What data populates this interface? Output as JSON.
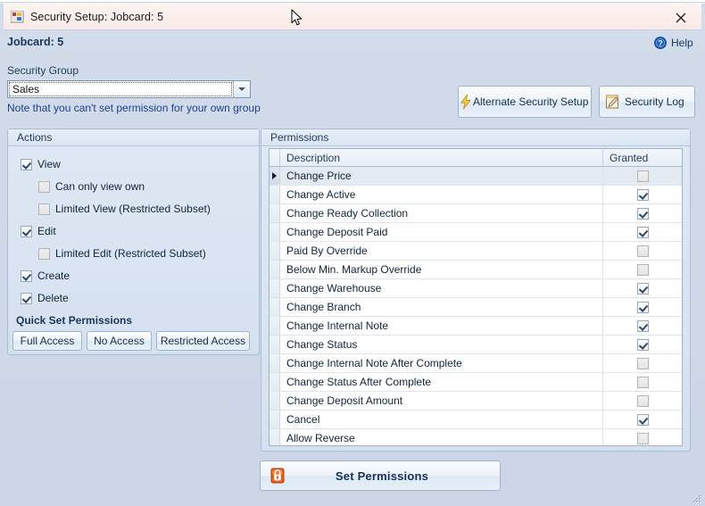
{
  "window": {
    "title": "Security Setup: Jobcard: 5",
    "app_icon": "windows-app-icon",
    "close_label": "✕"
  },
  "header": {
    "jobcard": "Jobcard: 5",
    "help_label": "Help",
    "help_icon": "help-question-icon"
  },
  "security_group": {
    "label": "Security Group",
    "selected": "Sales",
    "options": [
      "Sales"
    ],
    "note": "Note that you can't set permission for your own group"
  },
  "top_buttons": [
    {
      "label": "Alternate Security Setup",
      "icon": "lightning-bolt-icon"
    },
    {
      "label": "Security Log",
      "icon": "notepad-pencil-icon"
    }
  ],
  "actions": {
    "title": "Actions",
    "items": [
      {
        "label": "View",
        "checked": true,
        "indent": 0,
        "disabled": false
      },
      {
        "label": "Can only view own",
        "checked": false,
        "indent": 1,
        "disabled": true
      },
      {
        "label": "Limited View (Restricted Subset)",
        "checked": false,
        "indent": 1,
        "disabled": true
      },
      {
        "label": "Edit",
        "checked": true,
        "indent": 0,
        "disabled": false
      },
      {
        "label": "Limited Edit (Restricted Subset)",
        "checked": false,
        "indent": 1,
        "disabled": true
      },
      {
        "label": "Create",
        "checked": true,
        "indent": 0,
        "disabled": false
      },
      {
        "label": "Delete",
        "checked": true,
        "indent": 0,
        "disabled": false
      }
    ],
    "quick_set_title": "Quick Set Permissions",
    "quick_buttons": [
      {
        "label": "Full Access"
      },
      {
        "label": "No Access"
      },
      {
        "label": "Restricted Access"
      }
    ]
  },
  "permissions": {
    "title": "Permissions",
    "columns": [
      "Description",
      "Granted"
    ],
    "rows": [
      {
        "description": "Change Price",
        "granted": false,
        "selected": true
      },
      {
        "description": "Change Active",
        "granted": true,
        "selected": false
      },
      {
        "description": "Change Ready Collection",
        "granted": true,
        "selected": false
      },
      {
        "description": "Change Deposit Paid",
        "granted": true,
        "selected": false
      },
      {
        "description": "Paid By Override",
        "granted": false,
        "selected": false
      },
      {
        "description": "Below Min. Markup Override",
        "granted": false,
        "selected": false
      },
      {
        "description": "Change Warehouse",
        "granted": true,
        "selected": false
      },
      {
        "description": "Change Branch",
        "granted": true,
        "selected": false
      },
      {
        "description": "Change Internal Note",
        "granted": true,
        "selected": false
      },
      {
        "description": "Change Status",
        "granted": true,
        "selected": false
      },
      {
        "description": "Change Internal Note After Complete",
        "granted": false,
        "selected": false
      },
      {
        "description": "Change Status After Complete",
        "granted": false,
        "selected": false
      },
      {
        "description": "Change Deposit Amount",
        "granted": false,
        "selected": false
      },
      {
        "description": "Cancel",
        "granted": true,
        "selected": false
      },
      {
        "description": "Allow Reverse",
        "granted": false,
        "selected": false
      }
    ]
  },
  "footer": {
    "set_permissions_label": "Set Permissions",
    "set_permissions_icon": "lock-icon"
  },
  "colors": {
    "body_background": "#ccd6e6",
    "titlebar": "#fbeeeb",
    "accent_text": "#16365c",
    "note_text": "#1c3f8f",
    "grid_selection": "#e4eaf2"
  }
}
